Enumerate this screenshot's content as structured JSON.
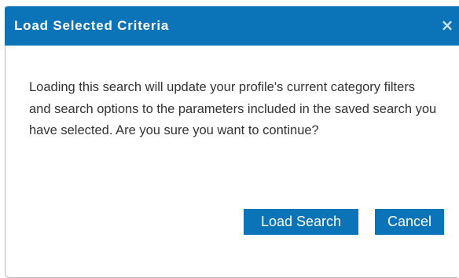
{
  "dialog": {
    "title": "Load Selected Criteria",
    "close_label": "×",
    "message": "Loading this search will update your profile's current category filters and search options to the parameters included in the saved search you have selected. Are you sure you want to continue?",
    "buttons": {
      "load_label": "Load Search",
      "cancel_label": "Cancel"
    }
  },
  "colors": {
    "accent": "#0b73b8",
    "text": "#333333",
    "border": "#bcbcbc"
  }
}
